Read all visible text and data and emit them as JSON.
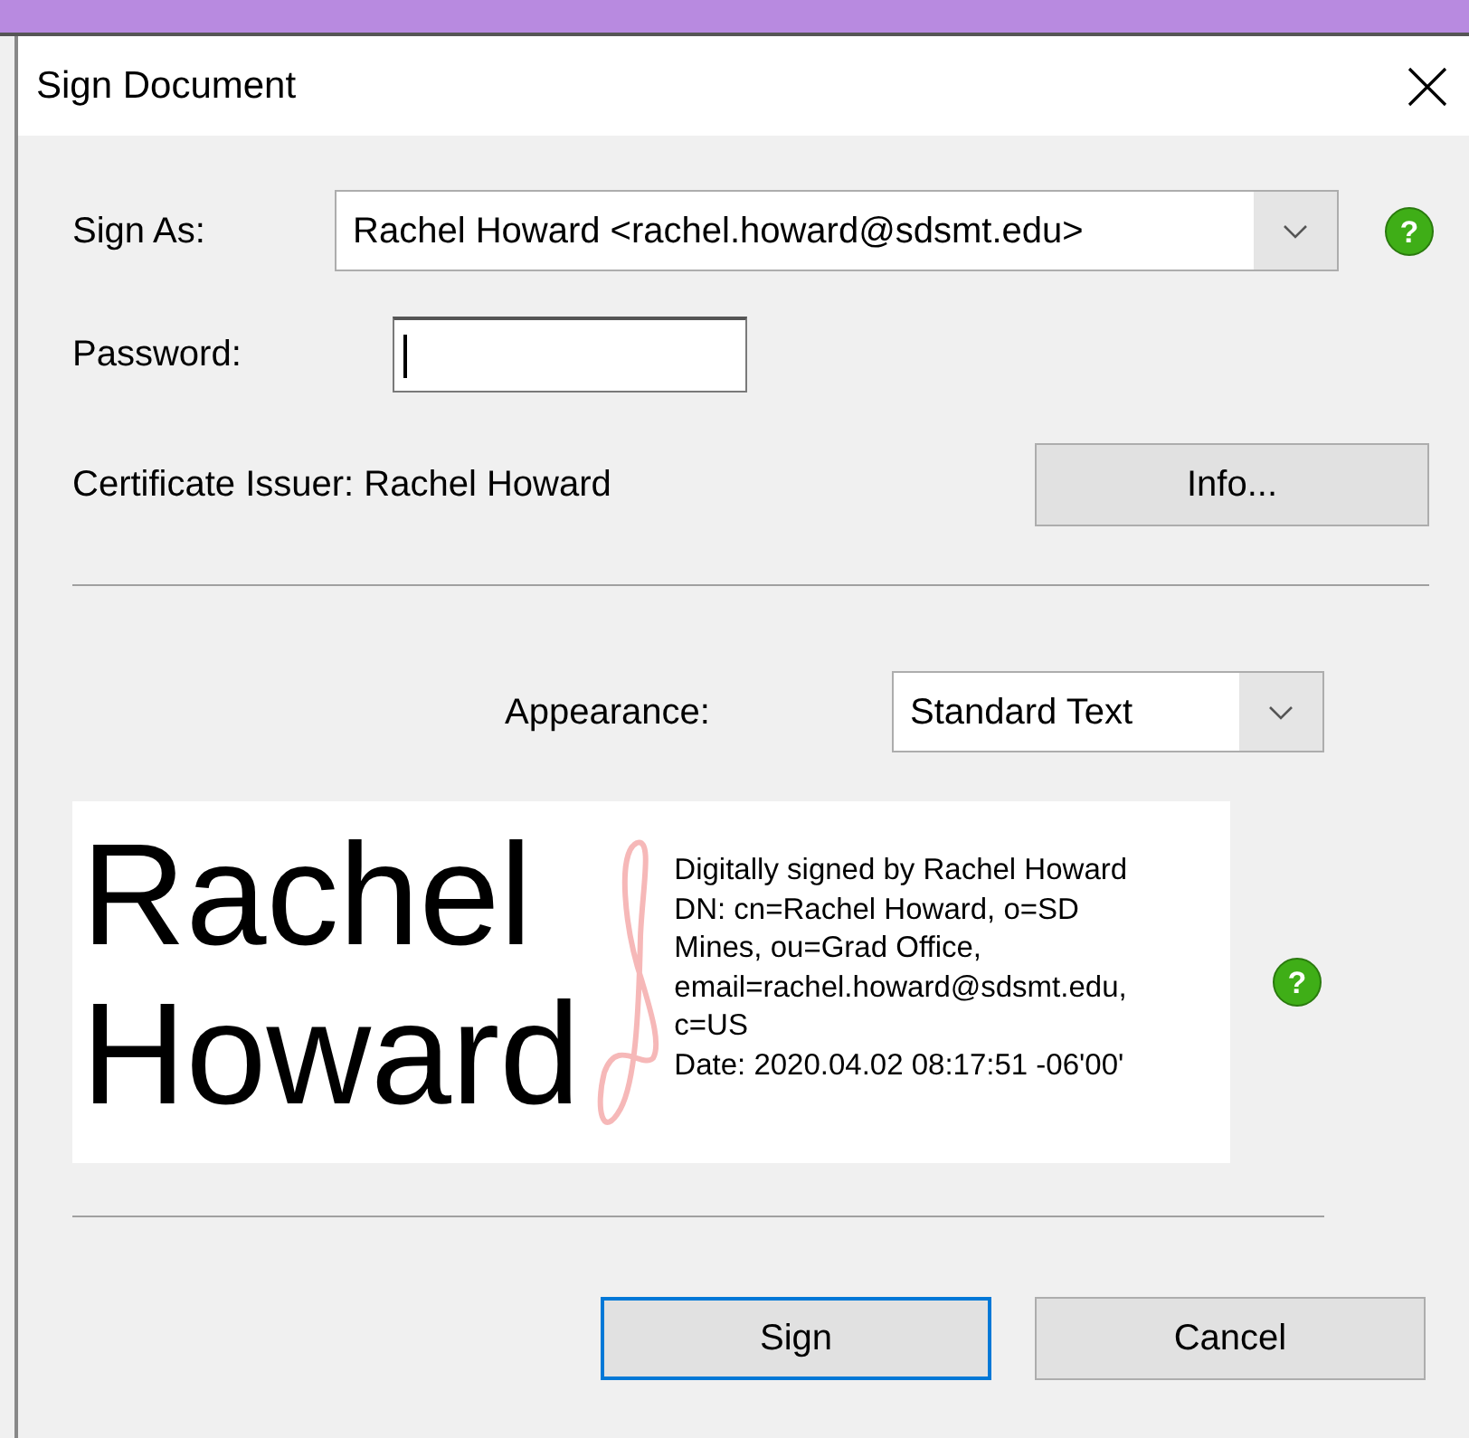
{
  "window": {
    "title": "Sign Document"
  },
  "sign_as": {
    "label": "Sign As:",
    "value": "Rachel Howard <rachel.howard@sdsmt.edu>",
    "help": "?"
  },
  "password": {
    "label": "Password:",
    "focused": true
  },
  "certificate_issuer": {
    "text": "Certificate Issuer: Rachel Howard",
    "button": "Info..."
  },
  "appearance": {
    "label": "Appearance:",
    "value": "Standard Text"
  },
  "preview": {
    "name_lines": [
      "Rachel",
      "Howard"
    ],
    "help": "?",
    "details": [
      "Digitally signed by Rachel Howard",
      "DN: cn=Rachel Howard, o=SD",
      "Mines, ou=Grad Office,",
      "email=rachel.howard@sdsmt.edu,",
      "c=US",
      "Date: 2020.04.02 08:17:51 -06'00'"
    ]
  },
  "buttons": [
    {
      "label": "Sign",
      "default": true
    },
    {
      "label": "Cancel",
      "default": false
    }
  ]
}
